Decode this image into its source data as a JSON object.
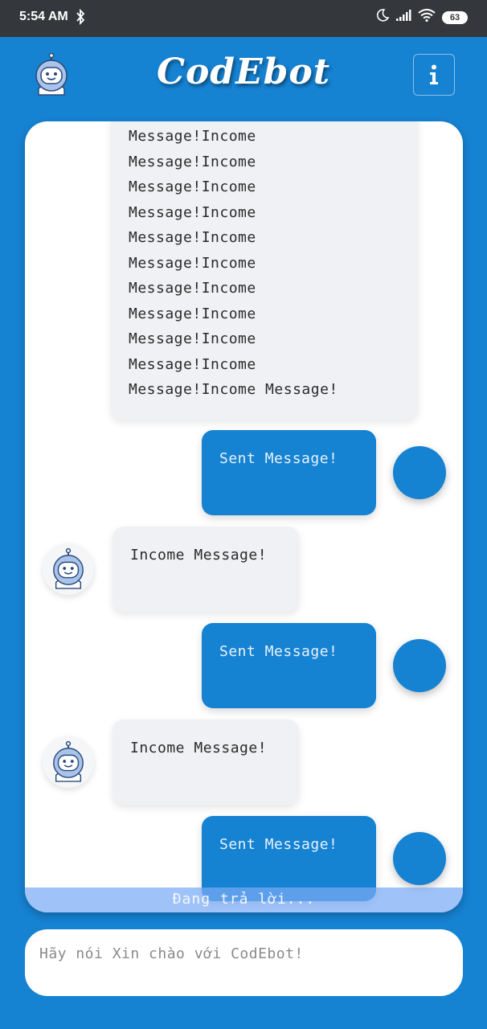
{
  "status_bar": {
    "time": "5:54 AM",
    "battery": "63",
    "icons": [
      "bluetooth-icon",
      "moon-icon",
      "signal-icon",
      "wifi-icon",
      "battery-icon"
    ]
  },
  "header": {
    "brand": "CodEbot",
    "info_label": "i"
  },
  "chat": {
    "first_income_lines": [
      "Message!Income",
      "Message!Income",
      "Message!Income",
      "Message!Income",
      "Message!Income",
      "Message!Income",
      "Message!Income",
      "Message!Income",
      "Message!Income",
      "Message!Income",
      "Message!Income Message!"
    ],
    "messages": [
      {
        "type": "sent",
        "text": "Sent Message!"
      },
      {
        "type": "income",
        "text": "Income Message!"
      },
      {
        "type": "sent",
        "text": "Sent Message!"
      },
      {
        "type": "income",
        "text": "Income Message!"
      },
      {
        "type": "sent",
        "text": "Sent Message!"
      }
    ],
    "typing_status": "Đang trả lời..."
  },
  "input": {
    "placeholder": "Hãy nói Xin chào với CodEbot!",
    "value": ""
  },
  "colors": {
    "primary": "#1682d2",
    "income_bubble": "#f0f1f4",
    "status_bar": "#34373b",
    "typing_bar": "#7aaaf5"
  }
}
